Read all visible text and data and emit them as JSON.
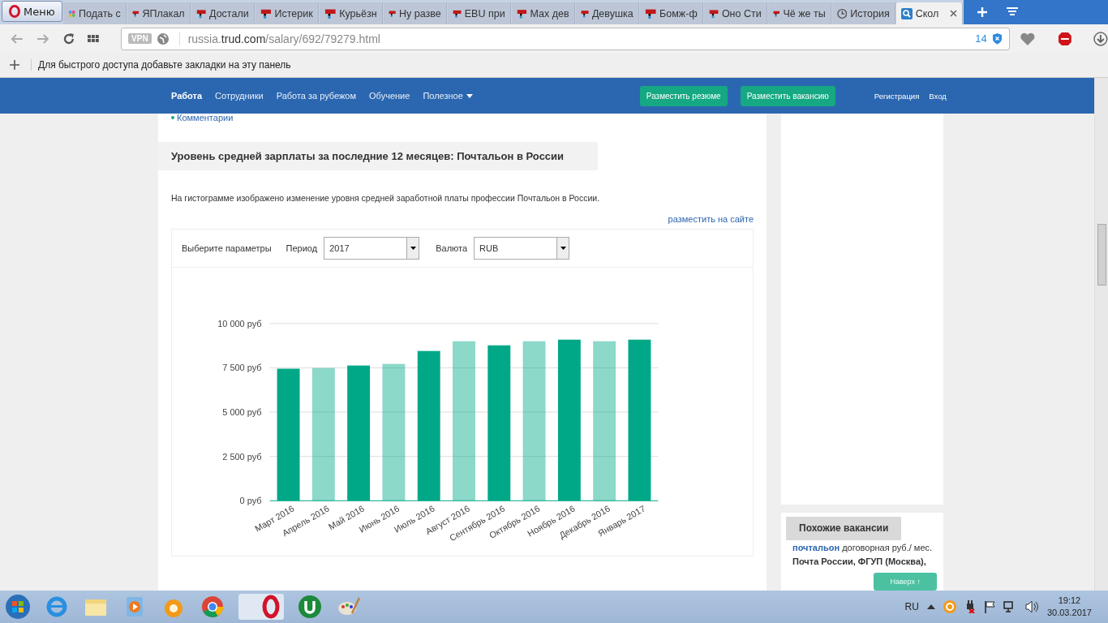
{
  "browser": {
    "menu_label": "Меню",
    "tabs": [
      {
        "title": "Подать с",
        "kind": "dots",
        "selected": false
      },
      {
        "title": "ЯПлакал",
        "kind": "yap",
        "selected": false
      },
      {
        "title": "Достали",
        "kind": "yap",
        "selected": false
      },
      {
        "title": "Истерик",
        "kind": "yap",
        "selected": false
      },
      {
        "title": "Курьёзн",
        "kind": "yap",
        "selected": false
      },
      {
        "title": "Ну разве",
        "kind": "yap",
        "selected": false
      },
      {
        "title": "EBU при",
        "kind": "yap",
        "selected": false
      },
      {
        "title": "Мах дев",
        "kind": "yap",
        "selected": false
      },
      {
        "title": "Девушка",
        "kind": "yap",
        "selected": false
      },
      {
        "title": "Бомж-ф",
        "kind": "yap",
        "selected": false
      },
      {
        "title": "Оно Сти",
        "kind": "yap",
        "selected": false
      },
      {
        "title": "Чё же ты",
        "kind": "yap",
        "selected": false
      },
      {
        "title": "История",
        "kind": "clock",
        "selected": false
      },
      {
        "title": "Скол",
        "kind": "search",
        "selected": true
      }
    ],
    "vpn_badge": "VPN",
    "url_host_prefix": "russia.",
    "url_host": "trud.com",
    "url_path": "/salary/692/79279.html",
    "blocked_count": "14",
    "bookmarks_hint": "Для быстрого доступа добавьте закладки на эту панель"
  },
  "site_nav": {
    "items": [
      {
        "label": "Работа",
        "selected": true
      },
      {
        "label": "Сотрудники",
        "selected": false
      },
      {
        "label": "Работа за рубежом",
        "selected": false
      },
      {
        "label": "Обучение",
        "selected": false
      },
      {
        "label": "Полезное",
        "selected": false
      }
    ],
    "buttons": [
      "Разместить резюме",
      "Разместить вакансию"
    ],
    "links": [
      "Регистрация",
      "Вход"
    ]
  },
  "main": {
    "comments_link": "Комментарии",
    "heading": "Уровень средней зарплаты за последние 12 месяцев: Почтальон в России",
    "description": "На гистограмме изображено изменение уровня средней заработной платы профессии Почтальон в России.",
    "embed_link": "разместить на сайте",
    "params_label": "Выберите параметры",
    "period": {
      "label": "Период",
      "value": "2017"
    },
    "currency": {
      "label": "Валюта",
      "value": "RUB"
    },
    "chart_data": {
      "type": "bar",
      "categories": [
        "Март 2016",
        "Апрель 2016",
        "Май 2016",
        "Июнь 2016",
        "Июль 2016",
        "Август 2016",
        "Сентябрь 2016",
        "Октябрь 2016",
        "Ноябрь 2016",
        "Декабрь 2016",
        "Январь 2017"
      ],
      "grid": true,
      "series": [
        {
          "color": "#00a887",
          "values": [
            7450,
            7490,
            7630,
            7720,
            8450,
            9000,
            8770,
            9000,
            9090,
            9000,
            9090
          ]
        }
      ],
      "ylim": [
        0,
        10000
      ],
      "yticks": [
        {
          "value": 0,
          "label": "0 руб"
        },
        {
          "value": 2500,
          "label": "2 500 руб"
        },
        {
          "value": 5000,
          "label": "5 000 руб"
        },
        {
          "value": 7500,
          "label": "7 500 руб"
        },
        {
          "value": 10000,
          "label": "10 000 руб"
        }
      ]
    }
  },
  "sidebar": {
    "similar_title": "Похожие вакансии",
    "vacancy_title": "почтальон",
    "vacancy_salary": "договорная руб./ мес.",
    "vacancy_company": "Почта России, ФГУП (Москва),",
    "to_top": "Наверх ↑"
  },
  "taskbar": {
    "language": "RU",
    "time": "19:12",
    "date": "30.03.2017"
  }
}
